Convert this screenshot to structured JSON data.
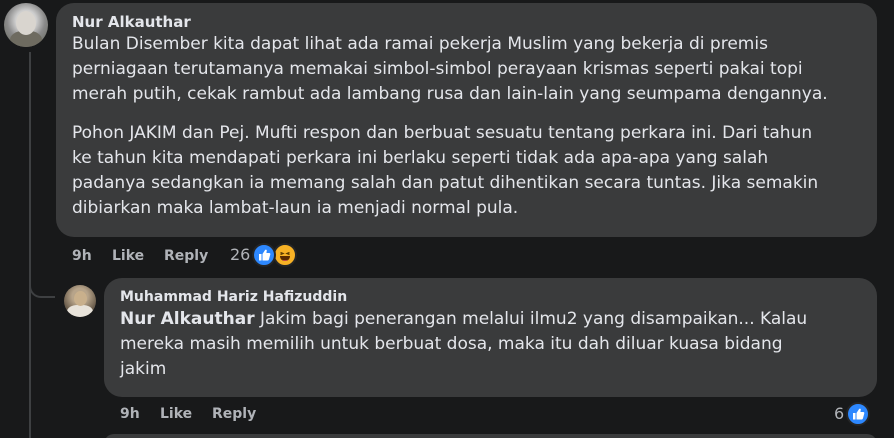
{
  "comment": {
    "author": "Nur Alkauthar",
    "paragraph1": [
      "Bulan Disember kita dapat lihat ada ramai pekerja Muslim yang bekerja di premis",
      "perniagaan terutamanya memakai simbol-simbol perayaan krismas seperti pakai topi",
      "merah putih, cekak rambut ada lambang rusa dan lain-lain yang seumpama dengannya."
    ],
    "paragraph2": [
      "Pohon JAKIM dan Pej. Mufti respon dan berbuat sesuatu tentang perkara ini. Dari tahun",
      "ke tahun kita mendapati perkara ini berlaku seperti tidak ada apa-apa yang salah",
      "padanya sedangkan ia memang salah dan patut dihentikan secara tuntas. Jika semakin",
      "dibiarkan maka lambat-laun ia menjadi normal pula."
    ],
    "time": "9h",
    "like_label": "Like",
    "reply_label": "Reply",
    "reaction_count": "26",
    "reactions": [
      "like-icon",
      "haha-icon"
    ]
  },
  "reply": {
    "author": "Muhammad Hariz Hafizuddin",
    "mention": "Nur Alkauthar",
    "line1_rest": " Jakim bagi penerangan melalui ilmu2 yang disampaikan... Kalau",
    "line2": "mereka masih memilih untuk berbuat dosa, maka itu dah diluar kuasa bidang",
    "line3": "jakim",
    "time": "9h",
    "like_label": "Like",
    "reply_label": "Reply",
    "reaction_count": "6",
    "reactions": [
      "like-icon"
    ]
  },
  "colors": {
    "background": "#18191a",
    "bubble": "#3a3b3c",
    "text": "#e4e6eb",
    "secondary_text": "#b0b3b8",
    "like_blue": "#2d88ff",
    "haha_yellow": "#f7b125"
  }
}
